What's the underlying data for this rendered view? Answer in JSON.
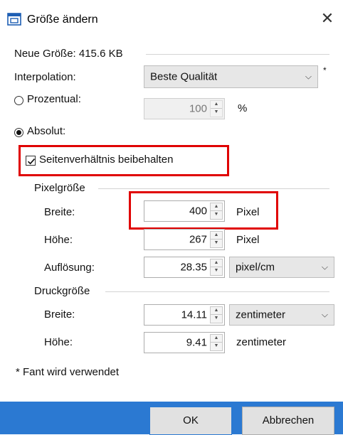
{
  "window": {
    "title": "Größe ändern",
    "close_glyph": "✕"
  },
  "new_size": {
    "text": "Neue Größe: 415.6 KB"
  },
  "interpolation": {
    "label": "Interpolation:",
    "selected": "Beste Qualität",
    "asterisk": "*"
  },
  "percent": {
    "label": "Prozentual:",
    "value": "100",
    "unit": "%",
    "selected": false
  },
  "absolute": {
    "label": "Absolut:",
    "selected": true,
    "keep_ratio_label": "Seitenverhältnis beibehalten",
    "keep_ratio_checked": true
  },
  "pixel_size": {
    "header": "Pixelgröße",
    "width_label": "Breite:",
    "width_value": "400",
    "width_unit": "Pixel",
    "height_label": "Höhe:",
    "height_value": "267",
    "height_unit": "Pixel",
    "resolution_label": "Auflösung:",
    "resolution_value": "28.35",
    "resolution_unit": "pixel/cm"
  },
  "print_size": {
    "header": "Druckgröße",
    "width_label": "Breite:",
    "width_value": "14.11",
    "width_unit": "zentimeter",
    "height_label": "Höhe:",
    "height_value": "9.41",
    "height_unit": "zentimeter"
  },
  "footnote": "* Fant wird verwendet",
  "buttons": {
    "ok": "OK",
    "cancel": "Abbrechen"
  },
  "colors": {
    "highlight": "#e00000",
    "footer": "#2b79d2"
  },
  "icons": {
    "app": "resize-window-icon",
    "close": "close-icon",
    "dropdown": "chevron-down-icon",
    "spinner": "spinner-arrows-icon",
    "check": "check-icon"
  }
}
